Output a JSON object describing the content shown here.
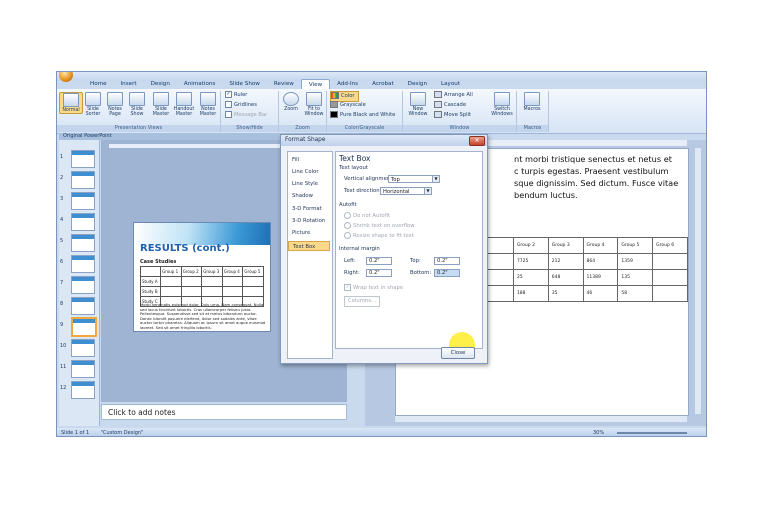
{
  "tabs": [
    "Home",
    "Insert",
    "Design",
    "Animations",
    "Slide Show",
    "Review",
    "View",
    "Add-Ins",
    "Acrobat",
    "Design",
    "Layout"
  ],
  "active_tab": "View",
  "ribbon": {
    "presentation_views": {
      "label": "Presentation Views",
      "buttons": [
        {
          "label": "Normal",
          "icon": "normal-view-icon"
        },
        {
          "label": "Slide Sorter",
          "icon": "slide-sorter-icon"
        },
        {
          "label": "Notes Page",
          "icon": "notes-page-icon"
        },
        {
          "label": "Slide Show",
          "icon": "slide-show-icon"
        },
        {
          "label": "Slide Master",
          "icon": "slide-master-icon"
        },
        {
          "label": "Handout Master",
          "icon": "handout-master-icon"
        },
        {
          "label": "Notes Master",
          "icon": "notes-master-icon"
        }
      ]
    },
    "show_hide": {
      "label": "Show/Hide",
      "items": [
        {
          "label": "Ruler",
          "checked": true
        },
        {
          "label": "Gridlines",
          "checked": false
        },
        {
          "label": "Message Bar",
          "checked": false
        }
      ]
    },
    "zoom": {
      "label": "Zoom",
      "buttons": [
        "Zoom",
        "Fit to Window"
      ]
    },
    "color": {
      "label": "Color/Grayscale",
      "items": [
        "Color",
        "Grayscale",
        "Pure Black and White"
      ]
    },
    "window": {
      "label": "Window",
      "new_window": "New Window",
      "items": [
        "Arrange All",
        "Cascade",
        "Move Split"
      ],
      "switch": "Switch Windows"
    },
    "macros": {
      "label": "Macros",
      "button": "Macros"
    }
  },
  "left_window_title": "Original PowerPoint",
  "thumbnail_numbers": [
    "1",
    "2",
    "3",
    "4",
    "5",
    "6",
    "7",
    "8",
    "9",
    "10",
    "11",
    "12"
  ],
  "selected_thumbnail": "9",
  "slide": {
    "title": "RESULTS (cont.)",
    "subtitle": "Case Studies",
    "table_headers": [
      "",
      "Group 1",
      "Group 2",
      "Group 3",
      "Group 4",
      "Group 5"
    ],
    "table_row_labels": [
      "Study A",
      "Study B",
      "Study C"
    ],
    "body": "Morbi venenatis euismod dolor. Duis urna. Nam consequat. Nulla sed lacus tincidunt lobortis. Cras ullamcorper feliseu justo. Pellentesque. Suspendisse sed sit at metus bibendum auctor. Donec blandit posuere eleifend, dolor sed sodales ante, vitae auctor tortor pharetra. Aliquam ac ipsum sit amet augue euismod laoreet. Sed sit amet fringilla lobortis."
  },
  "notes_placeholder": "Click to add notes",
  "right_doc": {
    "lines": [
      "nt morbi tristique senectus et netus et",
      "c turpis egestas. Praesent vestibulum",
      "sque dignissim. Sed dictum. Fusce vitae",
      "bendum luctus."
    ],
    "table_headers": [
      "",
      "Group 2",
      "Group 3",
      "Group 4",
      "Group 5",
      "Group 6"
    ],
    "table_rows": [
      [
        "",
        "7725",
        "212",
        "864",
        "1359"
      ],
      [
        "",
        "25",
        "648",
        "11389",
        "135"
      ],
      [
        "",
        "188",
        "35",
        "46",
        "58"
      ]
    ]
  },
  "status": {
    "slide": "Slide 1 of 1",
    "theme": "\"Custom Design\"",
    "zoom": "30%"
  },
  "dialog": {
    "title": "Format Shape",
    "close_x": "✕",
    "categories": [
      "Fill",
      "Line Color",
      "Line Style",
      "Shadow",
      "3-D Format",
      "3-D Rotation",
      "Picture",
      "Text Box"
    ],
    "selected_category": "Text Box",
    "heading": "Text Box",
    "text_layout": "Text layout",
    "vertical_alignment_label": "Vertical alignment:",
    "vertical_alignment_value": "Top",
    "text_direction_label": "Text direction:",
    "text_direction_value": "Horizontal",
    "autofit": "Autofit",
    "autofit_options": [
      "Do not Autofit",
      "Shrink text on overflow",
      "Resize shape to fit text"
    ],
    "internal_margin": "Internal margin",
    "left_label": "Left:",
    "left_value": "0.2\"",
    "top_label": "Top:",
    "top_value": "0.2\"",
    "right_label": "Right:",
    "right_value": "0.2\"",
    "bottom_label": "Bottom:",
    "bottom_value": "0.2\"",
    "wrap_text": "Wrap text in shape",
    "columns_button": "Columns...",
    "close_button": "Close"
  }
}
